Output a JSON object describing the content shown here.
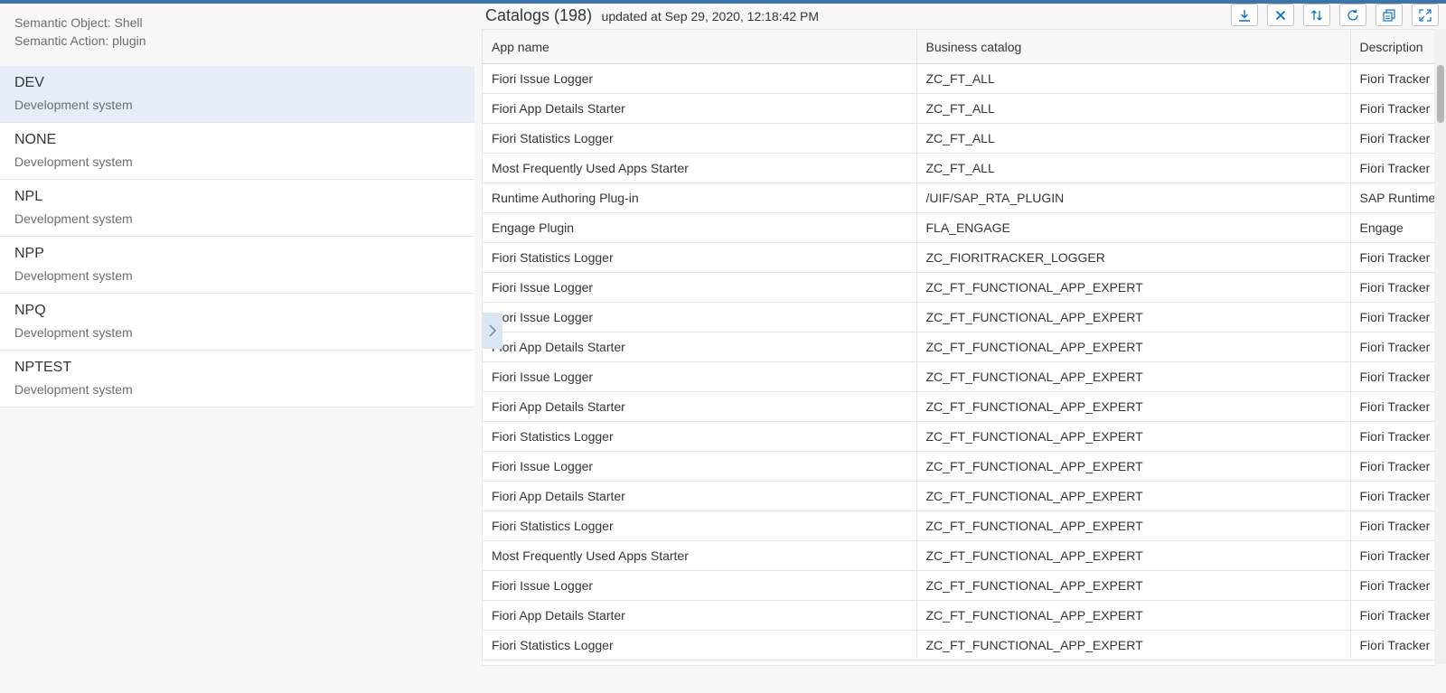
{
  "semantic": {
    "object": "Semantic Object: Shell",
    "action": "Semantic Action: plugin"
  },
  "systems": [
    {
      "name": "DEV",
      "desc": "Development system",
      "selected": true
    },
    {
      "name": "NONE",
      "desc": "Development system"
    },
    {
      "name": "NPL",
      "desc": "Development system"
    },
    {
      "name": "NPP",
      "desc": "Development system"
    },
    {
      "name": "NPQ",
      "desc": "Development system"
    },
    {
      "name": "NPTEST",
      "desc": "Development system"
    }
  ],
  "catalogs": {
    "title": "Catalogs (198)",
    "updated": "updated at Sep 29, 2020, 12:18:42 PM",
    "toolbar": [
      "download-icon",
      "close-icon",
      "sort-icon",
      "refresh-icon",
      "copy-icon",
      "fullscreen-icon"
    ],
    "columns": [
      "App name",
      "Business catalog",
      "Description"
    ],
    "rows": [
      [
        "Fiori Issue Logger",
        "ZC_FT_ALL",
        "Fiori Tracker"
      ],
      [
        "Fiori App Details Starter",
        "ZC_FT_ALL",
        "Fiori Tracker"
      ],
      [
        "Fiori Statistics Logger",
        "ZC_FT_ALL",
        "Fiori Tracker"
      ],
      [
        "Most Frequently Used Apps Starter",
        "ZC_FT_ALL",
        "Fiori Tracker"
      ],
      [
        "Runtime Authoring Plug-in",
        "/UIF/SAP_RTA_PLUGIN",
        "SAP Runtime"
      ],
      [
        "Engage Plugin",
        "FLA_ENGAGE",
        "Engage"
      ],
      [
        "Fiori Statistics Logger",
        "ZC_FIORITRACKER_LOGGER",
        "Fiori Tracker"
      ],
      [
        "Fiori Issue Logger",
        "ZC_FT_FUNCTIONAL_APP_EXPERT",
        "Fiori Tracker"
      ],
      [
        "Fiori Issue Logger",
        "ZC_FT_FUNCTIONAL_APP_EXPERT",
        "Fiori Tracker"
      ],
      [
        "Fiori App Details Starter",
        "ZC_FT_FUNCTIONAL_APP_EXPERT",
        "Fiori Tracker"
      ],
      [
        "Fiori Issue Logger",
        "ZC_FT_FUNCTIONAL_APP_EXPERT",
        "Fiori Tracker"
      ],
      [
        "Fiori App Details Starter",
        "ZC_FT_FUNCTIONAL_APP_EXPERT",
        "Fiori Tracker"
      ],
      [
        "Fiori Statistics Logger",
        "ZC_FT_FUNCTIONAL_APP_EXPERT",
        "Fiori Tracker"
      ],
      [
        "Fiori Issue Logger",
        "ZC_FT_FUNCTIONAL_APP_EXPERT",
        "Fiori Tracker"
      ],
      [
        "Fiori App Details Starter",
        "ZC_FT_FUNCTIONAL_APP_EXPERT",
        "Fiori Tracker"
      ],
      [
        "Fiori Statistics Logger",
        "ZC_FT_FUNCTIONAL_APP_EXPERT",
        "Fiori Tracker"
      ],
      [
        "Most Frequently Used Apps Starter",
        "ZC_FT_FUNCTIONAL_APP_EXPERT",
        "Fiori Tracker"
      ],
      [
        "Fiori Issue Logger",
        "ZC_FT_FUNCTIONAL_APP_EXPERT",
        "Fiori Tracker"
      ],
      [
        "Fiori App Details Starter",
        "ZC_FT_FUNCTIONAL_APP_EXPERT",
        "Fiori Tracker"
      ],
      [
        "Fiori Statistics Logger",
        "ZC_FT_FUNCTIONAL_APP_EXPERT",
        "Fiori Tracker"
      ]
    ]
  },
  "expand_icon": "chevron-right-icon",
  "colors": {
    "accent": "#0a6ed1",
    "topbar": "#3f74a8",
    "selected": "#e5eef8"
  }
}
